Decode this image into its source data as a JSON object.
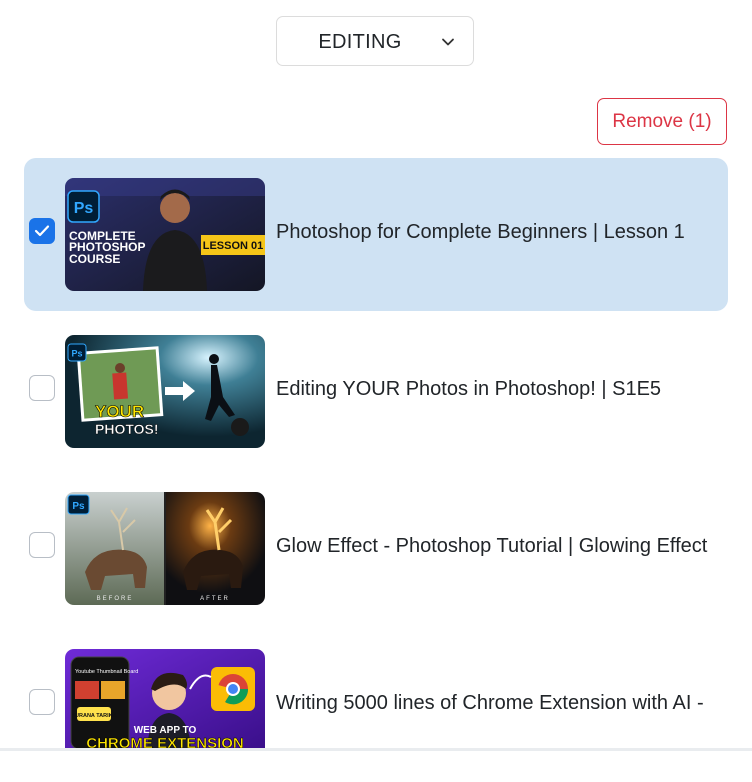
{
  "filter": {
    "selected": "EDITING",
    "icon": "chevron-down-icon"
  },
  "actions": {
    "remove_label": "Remove (1)"
  },
  "videos": [
    {
      "title": "Photoshop for Complete Beginners | Lesson 1",
      "selected": true,
      "thumb_text": {
        "badge": "Ps",
        "line1": "COMPLETE",
        "line2": "PHOTOSHOP",
        "line3": "COURSE",
        "lesson": "LESSON 01"
      }
    },
    {
      "title": "Editing YOUR Photos in Photoshop! | S1E5",
      "selected": false,
      "thumb_text": {
        "badge": "Ps",
        "line1": "YOUR",
        "line2": "PHOTOS!"
      }
    },
    {
      "title": "Glow Effect - Photoshop Tutorial | Glowing Effect",
      "selected": false,
      "thumb_text": {
        "badge": "Ps",
        "before": "BEFORE",
        "after": "AFTER"
      }
    },
    {
      "title": "Writing 5000 lines of Chrome Extension with AI -",
      "selected": false,
      "thumb_text": {
        "line1": "WEB APP TO",
        "line2": "CHROME EXTENSION",
        "phone": "Youtube Thumbnail Board",
        "sticker": "PURANA TARIKA"
      }
    }
  ],
  "colors": {
    "selected_row": "#cfe2f3",
    "checkbox_checked": "#1a73e8",
    "danger": "#dc3545"
  }
}
